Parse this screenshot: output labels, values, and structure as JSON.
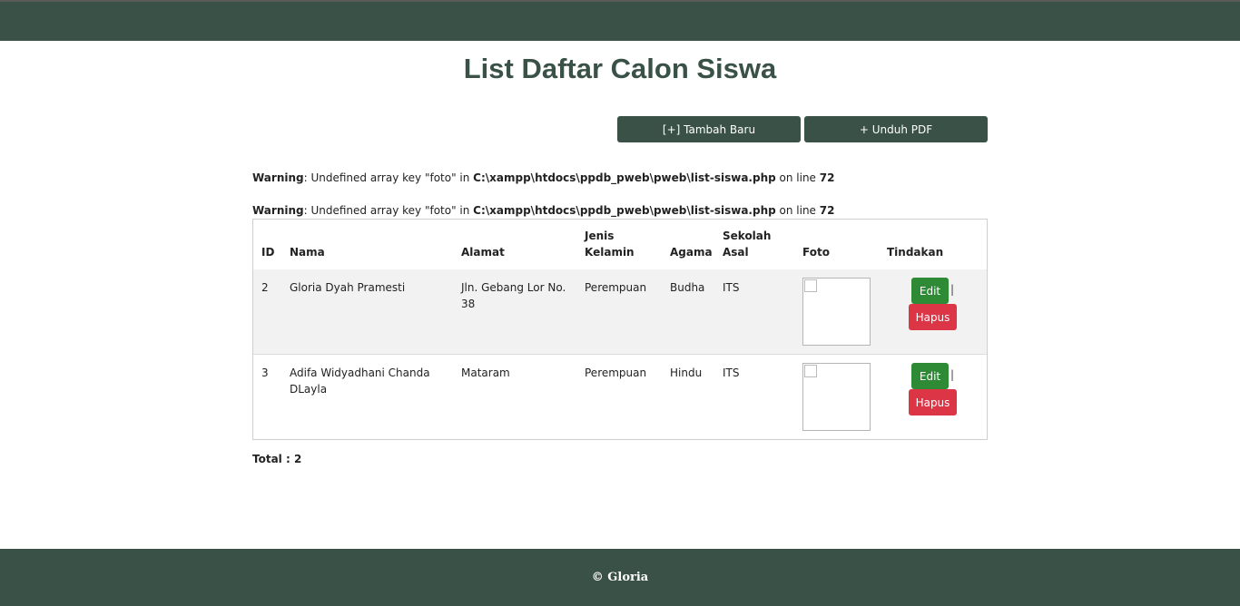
{
  "page": {
    "title": "List Daftar Calon Siswa"
  },
  "toolbar": {
    "add_label": "[+] Tambah Baru",
    "pdf_label": "+ Unduh PDF"
  },
  "warnings": [
    {
      "label": "Warning",
      "message": ": Undefined array key \"foto\" in ",
      "file": "C:\\xampp\\htdocs\\ppdb_pweb\\pweb\\list-siswa.php",
      "on_line_text": " on line ",
      "line": "72"
    },
    {
      "label": "Warning",
      "message": ": Undefined array key \"foto\" in ",
      "file": "C:\\xampp\\htdocs\\ppdb_pweb\\pweb\\list-siswa.php",
      "on_line_text": " on line ",
      "line": "72"
    }
  ],
  "table": {
    "headers": {
      "id": "ID",
      "nama": "Nama",
      "alamat": "Alamat",
      "jenis_1": "Jenis",
      "jenis_2": "Kelamin",
      "agama": "Agama",
      "sekolah_1": "Sekolah",
      "sekolah_2": "Asal",
      "foto": "Foto",
      "tindakan": "Tindakan"
    },
    "rows": [
      {
        "id": "2",
        "nama": "Gloria Dyah Pramesti",
        "alamat_1": "Jln. Gebang Lor No.",
        "alamat_2": "38",
        "jenis_kelamin": "Perempuan",
        "agama": "Budha",
        "sekolah_asal": "ITS",
        "edit_label": "Edit",
        "separator": "|",
        "delete_label": "Hapus"
      },
      {
        "id": "3",
        "nama_1": "Adifa Widyadhani Chanda",
        "nama_2": "DLayla",
        "alamat": "Mataram",
        "jenis_kelamin": "Perempuan",
        "agama": "Hindu",
        "sekolah_asal": "ITS",
        "edit_label": "Edit",
        "separator": "|",
        "delete_label": "Hapus"
      }
    ]
  },
  "total": {
    "text": "Total : 2"
  },
  "footer": {
    "text": "© Gloria"
  },
  "colors": {
    "primary": "#3a5147",
    "edit": "#2f8a35",
    "delete": "#dc3545",
    "row_striped": "#f2f2f2"
  }
}
